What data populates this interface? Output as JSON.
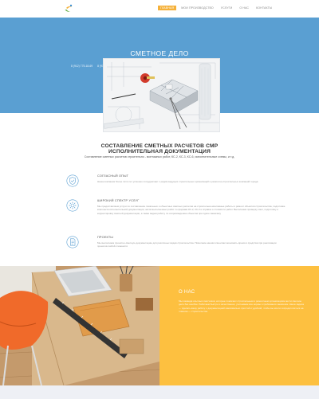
{
  "nav": {
    "items": [
      {
        "label": "ГЛАВНАЯ",
        "active": true
      },
      {
        "label": "МОИ ПРОИЗВОДСТВО",
        "active": false
      },
      {
        "label": "УСЛУГИ",
        "active": false
      },
      {
        "label": "О НАС",
        "active": false
      },
      {
        "label": "КОНТАКТЫ",
        "active": false
      }
    ],
    "accent_color": "#f5b13a"
  },
  "hero": {
    "title": "СМЕТНОЕ ДЕЛО",
    "phone1": "8 (912) 775-18-69",
    "phone2": "8 (912) 652-98-32",
    "email": "info@smetnoe.com.ru",
    "background_color": "#5a9fd2"
  },
  "services": {
    "title_line1": "СОСТАВЛЕНИЕ СМЕТНЫХ РАСЧЕТОВ СМР",
    "title_line2": "ИСПОЛНИТЕЛЬНАЯ ДОКУМЕНТАЦИЯ",
    "subtitle": "Составление сметных расчетов строительно - монтажных работ, КС-2, КС-3, КС-6, исполнительные схемы, и т.д.",
    "features": [
      {
        "icon": "shield-check-icon",
        "title": "СОГЛАСНЫЙ ОПЫТ",
        "text": "Наша компания более пяти лет успешно сотрудничает с рядом ведущих строительных организаций и ремонтно-строительных компаний города"
      },
      {
        "icon": "gear-icon",
        "title": "ШИРОКИЙ СПЕКТР УСЛУГ",
        "text": "Мы предоставляем услуги по составлению локальных и объектных сметных расчетов на строительно-монтажные работы и ремонт объектов строительства, подготовке комплекта исполнительной документации, актов выполненных работ по формам КС-2, КС-3 и справок о стоимости работ. Выполняем проверку смет, подготовку и корректировку сметной документации, а также ведем работу по сопровождению объектов при сдаче заказчику"
      },
      {
        "icon": "document-icon",
        "title": "ПРОЕКТЫ",
        "text": "Мы выполняем проектно-сметную документацию для различных видов строительства. Помогаем нашим клиентам экономить время и средства при реализации проектов любой сложности"
      }
    ]
  },
  "about": {
    "title": "О НАС",
    "text": "Мы команда опытных сметчиков, которые помогают строительным и ремонтным организациям вести сметное дело без ошибок. Работаем быстро и качественно, учитываем все нормы и требования заказчика. Наша задача — сделать вашу работу с документацией максимально простой и удобной, чтобы вы могли сосредоточиться на главном — строительстве",
    "background_color": "#fdc040"
  }
}
